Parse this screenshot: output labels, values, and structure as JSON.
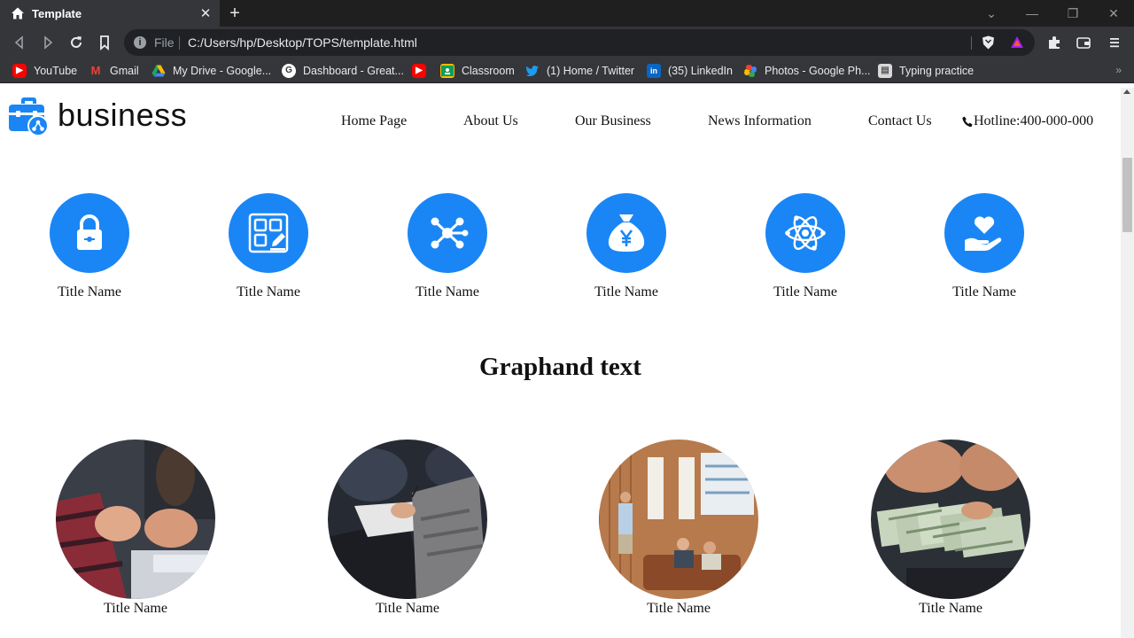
{
  "browser": {
    "tab_title": "Template",
    "tab_close": "✕",
    "new_tab": "+",
    "scheme_label": "File",
    "url": "C:/Users/hp/Desktop/TOPS/template.html",
    "window_controls": {
      "collapse": "⌄",
      "minimize": "—",
      "restore": "❐",
      "close": "✕"
    },
    "bookmarks": [
      {
        "label": "YouTube",
        "icon": "youtube-icon",
        "color": "#ff0000"
      },
      {
        "label": "Gmail",
        "icon": "gmail-icon",
        "color": "#ea4335"
      },
      {
        "label": "My Drive - Google...",
        "icon": "google-drive-icon",
        "color": "#1fa463"
      },
      {
        "label": "Dashboard - Great...",
        "icon": "google-g-icon",
        "color": "#ffffff"
      },
      {
        "label": "",
        "icon": "youtube-icon",
        "color": "#ff0000"
      },
      {
        "label": "Classroom",
        "icon": "classroom-icon",
        "color": "#0f9d58"
      },
      {
        "label": "(1) Home / Twitter",
        "icon": "twitter-icon",
        "color": "#1d9bf0"
      },
      {
        "label": "(35) LinkedIn",
        "icon": "linkedin-icon",
        "color": "#0a66c2"
      },
      {
        "label": "Photos - Google Ph...",
        "icon": "google-photos-icon",
        "color": "#fbbc04"
      },
      {
        "label": "Typing practice",
        "icon": "typing-icon",
        "color": "#dddddd"
      }
    ],
    "bookmarks_overflow": "»"
  },
  "site": {
    "logo_text": "business",
    "nav": [
      "Home Page",
      "About Us",
      "Our Business",
      "News Information",
      "Contact Us"
    ],
    "hotline": "Hotline:400-000-000",
    "accent_color": "#1a86f5",
    "features": [
      {
        "title": "Title Name",
        "icon": "lock-icon"
      },
      {
        "title": "Title Name",
        "icon": "edit-grid-icon"
      },
      {
        "title": "Title Name",
        "icon": "network-nodes-icon"
      },
      {
        "title": "Title Name",
        "icon": "money-bag-yen-icon"
      },
      {
        "title": "Title Name",
        "icon": "atom-icon"
      },
      {
        "title": "Title Name",
        "icon": "hand-heart-icon"
      }
    ],
    "section_heading": "Graphand text",
    "photos": [
      {
        "title": "Title Name",
        "image": "meeting-hands-photo"
      },
      {
        "title": "Title Name",
        "image": "note-taking-photo"
      },
      {
        "title": "Title Name",
        "image": "office-presentation-photo"
      },
      {
        "title": "Title Name",
        "image": "cash-banknotes-photo"
      }
    ]
  }
}
